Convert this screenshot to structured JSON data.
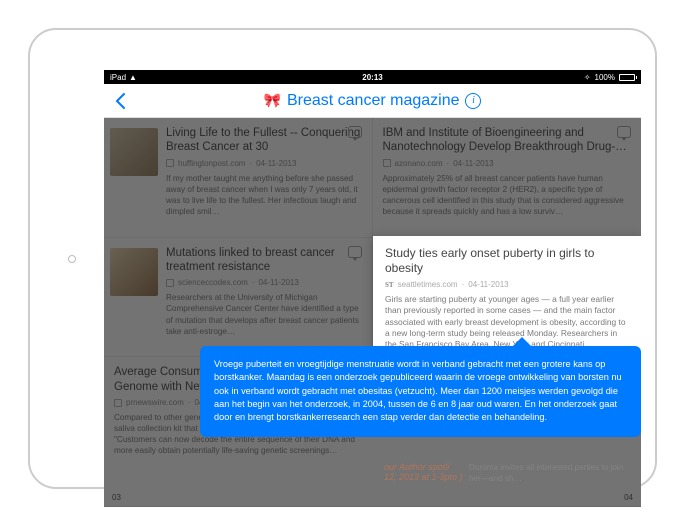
{
  "status_bar": {
    "carrier": "iPad",
    "time": "20:13",
    "battery_pct": "100%"
  },
  "nav": {
    "title": "Breast cancer magazine"
  },
  "cards": {
    "a": {
      "title": "Living Life to the Fullest -- Conquering Breast Cancer at 30",
      "source": "huffingtonpost.com",
      "date": "04-11-2013",
      "excerpt": "If my mother taught me anything before she passed away of breast cancer when I was only 7 years old, it was to live life to the fullest. Her infectious laugh and dimpled smil…"
    },
    "b": {
      "title": "IBM and Institute of Bioengineering and Nanotechnology Develop Breakthrough Drug-…",
      "source": "azonano.com",
      "date": "04-11-2013",
      "excerpt": "Approximately 25% of all breast cancer patients have human epidermal growth factor receptor 2 (HER2), a specific type of cancerous cell identified in this study that is considered aggressive because it spreads quickly and has a low surviv…"
    },
    "c": {
      "title": "Mutations linked to breast cancer treatment resistance",
      "source": "scienceccodex.com",
      "date": "04-11-2013",
      "excerpt": "Researchers at the University of Michigan Comprehensive Cancer Center have identified a type of mutation that develops after breast cancer patients take anti-estroge…"
    },
    "d": {
      "title": "Study ties early onset puberty in girls to obesity",
      "source": "seattletimes.com",
      "date": "04-11-2013",
      "excerpt": "Girls are starting puberty at younger ages — a full year earlier than previously reported in some cases — and the main factor associated with early breast development is obesity, according to a new long-term study being released Monday. Researchers in the San Francisco Bay Area, New York and Cincinnati…"
    },
    "e": {
      "title": "Average Consumer Can Now Store Entire Genome with New Product MyDNA Safe",
      "source": "prnewswire.com",
      "date": "04-11-2013",
      "excerpt": "Compared to other genetic tests, MyDNA Safe utilizes a simple saliva collection kit that allows consumers to easily store their DNA. \"Customers can now decode the entire sequence of their DNA and more easily obtain potentially life-saving genetic screenings…"
    },
    "f_fragment_title": "our Author spotli",
    "f_fragment_sub": "12, 2013 at 1-3pm )",
    "f_fragment_excerpt": "Duroma invites all interested parties to join her—and sh…"
  },
  "tooltip": {
    "text": "Vroege puberteit en vroegtijdige menstruatie wordt in verband gebracht met een grotere kans op borstkanker. Maandag is een onderzoek gepubliceerd waarin de vroege ontwikkeling van borsten nu ook in verband wordt gebracht met obesitas (vetzucht). Meer dan 1200 meisjes werden gevolgd die aan het begin van het onderzoek, in 2004, tussen de 6 en 8 jaar oud waren. En het onderzoek gaat door en brengt borstkankerresearch een stap verder dan detectie en behandeling."
  },
  "pagination": {
    "left": "03",
    "right": "04"
  }
}
